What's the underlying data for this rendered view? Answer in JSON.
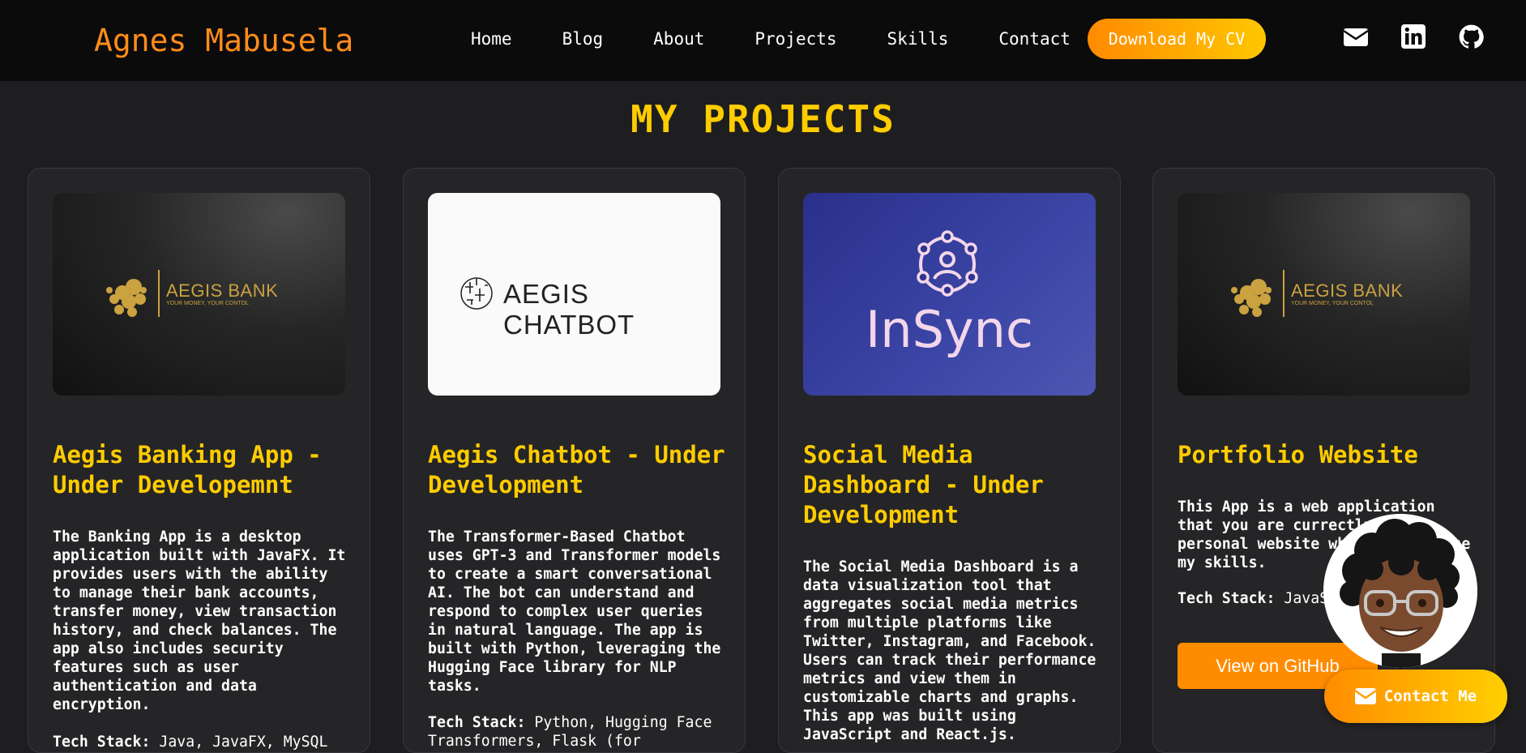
{
  "nav": {
    "brand": "Agnes Mabusela",
    "links": [
      "Home",
      "Blog",
      "About",
      "Projects",
      "Skills",
      "Contact"
    ],
    "cv_button": "Download My CV",
    "social_icons": [
      "envelope-icon",
      "linkedin-icon",
      "github-icon"
    ]
  },
  "page_title": "MY PROJECTS",
  "projects": [
    {
      "logo_text": "AEGIS BANK",
      "logo_tagline": "YOUR MONEY, YOUR CONTOL",
      "title": "Aegis Banking App - Under Developemnt",
      "desc": [
        "The Banking App is a desktop application built with ",
        "JavaFX",
        ". It provides users with the ability to manage their bank accounts, transfer money, view transaction history, and check balances. The app also includes security features such as user authentication and data encryption."
      ],
      "tech_label": "Tech Stack:",
      "tech_value": "Java, JavaFX, MySQL"
    },
    {
      "logo_text": "AEGIS CHATBOT",
      "title": "Aegis Chatbot - Under Development",
      "desc": [
        "The Transformer-Based Chatbot uses ",
        "GPT-3",
        " and ",
        "Transformer",
        " models to create a smart conversational AI. The bot can understand and respond to complex user queries in natural language. The app is built with ",
        "Python",
        ", leveraging the ",
        "Hugging Face",
        " library for NLP tasks."
      ],
      "tech_label": "Tech Stack:",
      "tech_value": "Python, Hugging Face Transformers, Flask (for"
    },
    {
      "logo_text": "InSync",
      "title": "Social Media Dashboard - Under Development",
      "desc": [
        "The Social Media Dashboard is a data visualization tool that aggregates social media metrics from multiple platforms like Twitter, Instagram, and Facebook. Users can track their performance metrics and view them in customizable charts and graphs. This app was built using ",
        "JavaScript",
        " and ",
        "React.js",
        "."
      ]
    },
    {
      "logo_text": "AEGIS BANK",
      "logo_tagline": "YOUR MONEY, YOUR CONTOL",
      "title": "Portfolio Website",
      "desc": [
        "This App is a web application that you are currectly on, my personal website where I showcase my skills."
      ],
      "tech_label": "Tech Stack:",
      "tech_value": "JavaScript, HTML, CSS",
      "button": "View on GitHub"
    }
  ],
  "contact_button": "Contact Me",
  "colors": {
    "accent": "#ffcc00",
    "orange": "#ff8c00",
    "bg": "#1e1e20",
    "nav_bg": "#0b0b0c"
  }
}
